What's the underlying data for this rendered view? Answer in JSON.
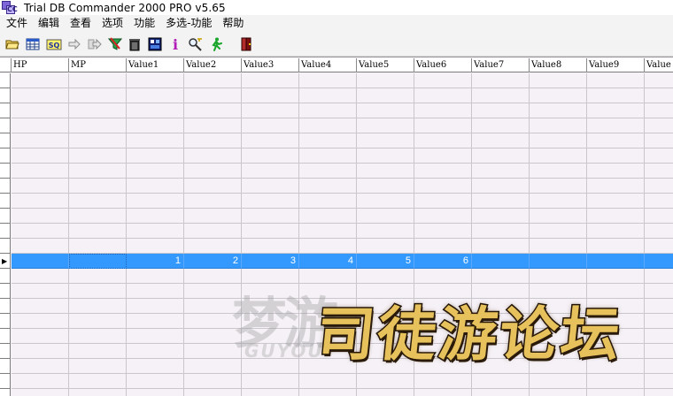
{
  "window": {
    "title": "Trial DB Commander 2000 PRO v5.65",
    "icon": "db-commander-app-icon",
    "icon_letters": "CC"
  },
  "menubar": {
    "items": [
      "文件",
      "编辑",
      "查看",
      "选项",
      "功能",
      "多选-功能",
      "帮助"
    ]
  },
  "toolbar": {
    "buttons": [
      {
        "icon": "open-folder-icon"
      },
      {
        "icon": "table-grid-icon"
      },
      {
        "icon": "sql-query-icon",
        "label": "SQ"
      },
      {
        "icon": "arrow-right-icon"
      },
      {
        "icon": "export-arrow-icon"
      },
      {
        "icon": "filter-funnel-icon"
      },
      {
        "icon": "trash-delete-icon"
      },
      {
        "icon": "database-image-icon"
      },
      {
        "icon": "info-icon",
        "label": "i"
      },
      {
        "icon": "search-key-icon"
      },
      {
        "icon": "run-man-icon"
      },
      {
        "icon": "exit-door-icon"
      }
    ]
  },
  "grid": {
    "columns": [
      "HP",
      "MP",
      "Value1",
      "Value2",
      "Value3",
      "Value4",
      "Value5",
      "Value6",
      "Value7",
      "Value8",
      "Value9",
      "Value"
    ],
    "selected_row": {
      "indicator": "▶",
      "cells": [
        "",
        "",
        "1",
        "2",
        "3",
        "4",
        "5",
        "6",
        "",
        "",
        "",
        ""
      ]
    }
  },
  "watermark": {
    "faint_text": "梦游",
    "sub_text": "GUYOU",
    "main_text": "司徒游论坛"
  }
}
